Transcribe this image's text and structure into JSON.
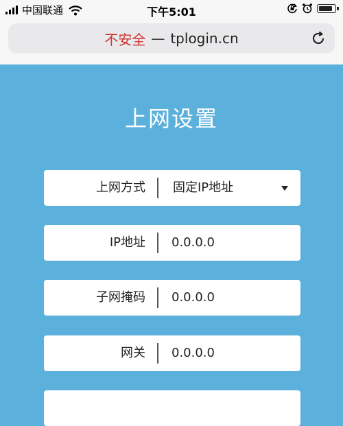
{
  "status_bar": {
    "carrier": "中国联通",
    "time": "下午5:01",
    "battery_level": 0.9
  },
  "address_bar": {
    "security_label": "不安全",
    "separator": "—",
    "domain": "tplogin.cn"
  },
  "page": {
    "title": "上网设置",
    "fields": [
      {
        "label": "上网方式",
        "value": "固定IP地址",
        "type": "select"
      },
      {
        "label": "IP地址",
        "value": "0.0.0.0",
        "type": "input"
      },
      {
        "label": "子网掩码",
        "value": "0.0.0.0",
        "type": "input"
      },
      {
        "label": "网关",
        "value": "0.0.0.0",
        "type": "input"
      },
      {
        "label": "",
        "value": "",
        "type": "input"
      }
    ]
  },
  "colors": {
    "page_background": "#5cb0dc",
    "insecure_text": "#d0312d",
    "field_background": "#ffffff"
  },
  "icons": [
    "signal-icon",
    "wifi-icon",
    "lock-rotation-icon",
    "alarm-icon",
    "battery-icon",
    "reload-icon",
    "dropdown-caret-icon"
  ]
}
